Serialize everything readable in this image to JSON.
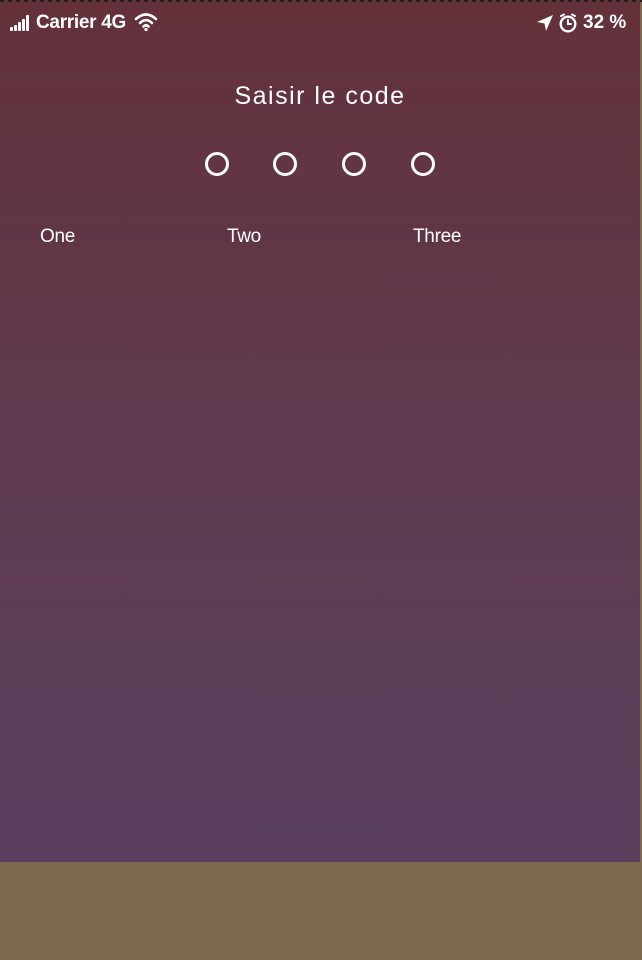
{
  "status_bar": {
    "carrier": "Carrier 4G",
    "battery": "32 %",
    "icons": [
      "signal-icon",
      "wifi-icon",
      "location-arrow-icon",
      "alarm-clock-icon"
    ]
  },
  "title": "Saisir le code",
  "code": {
    "length": 4,
    "filled": 0
  },
  "options": [
    {
      "label": "One"
    },
    {
      "label": "Two"
    },
    {
      "label": "Three"
    }
  ],
  "colors": {
    "background_top": "#64313a",
    "background_bottom": "#5b3f5f",
    "footer": "#7b694e",
    "text": "#ffffff"
  }
}
